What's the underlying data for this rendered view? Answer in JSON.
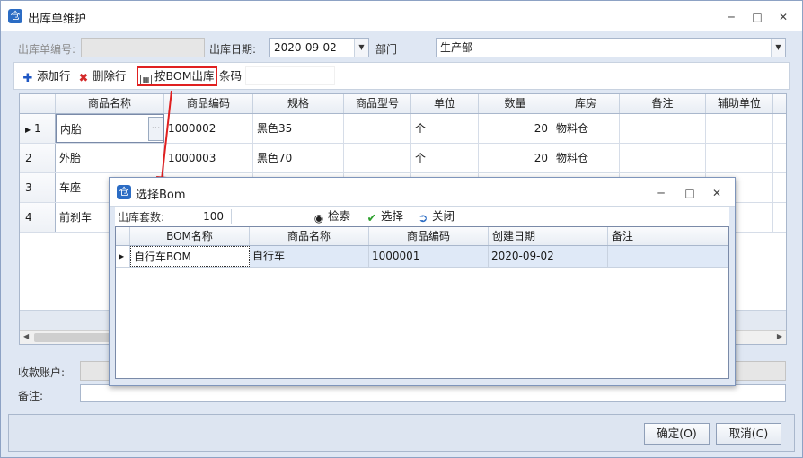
{
  "window": {
    "title": "出库单维护"
  },
  "form": {
    "order_no_label": "出库单编号:",
    "order_no_value": "",
    "date_label": "出库日期:",
    "date_value": "2020-09-02",
    "dept_label": "部门",
    "dept_value": "生产部",
    "account_label": "收款账户:",
    "account_value": "",
    "remark_label": "备注:",
    "remark_value": ""
  },
  "toolbar": {
    "add_label": "添加行",
    "delete_label": "删除行",
    "bom_label": "按BOM出库",
    "barcode_label": "条码",
    "barcode_value": ""
  },
  "grid": {
    "columns": [
      "商品名称",
      "商品编码",
      "规格",
      "商品型号",
      "单位",
      "数量",
      "库房",
      "备注",
      "辅助单位"
    ],
    "rows": [
      {
        "no": "1",
        "name": "内胎",
        "code": "1000002",
        "spec": "黑色35",
        "model": "",
        "unit": "个",
        "qty": "20",
        "warehouse": "物料仓",
        "note": "",
        "aux": ""
      },
      {
        "no": "2",
        "name": "外胎",
        "code": "1000003",
        "spec": "黑色70",
        "model": "",
        "unit": "个",
        "qty": "20",
        "warehouse": "物料仓",
        "note": "",
        "aux": ""
      },
      {
        "no": "3",
        "name": "车座",
        "code": "",
        "spec": "",
        "model": "",
        "unit": "",
        "qty": "",
        "warehouse": "",
        "note": "",
        "aux": ""
      },
      {
        "no": "4",
        "name": "前刹车",
        "code": "",
        "spec": "",
        "model": "",
        "unit": "",
        "qty": "",
        "warehouse": "",
        "note": "",
        "aux": ""
      }
    ],
    "ellipsis": "···"
  },
  "buttons": {
    "ok_label": "确定(O)",
    "cancel_label": "取消(C)"
  },
  "dialog": {
    "title": "选择Bom",
    "sets_label": "出库套数:",
    "sets_value": "100",
    "search_label": "检索",
    "select_label": "选择",
    "close_label": "关闭",
    "columns": [
      "BOM名称",
      "商品名称",
      "商品编码",
      "创建日期",
      "备注"
    ],
    "rows": [
      {
        "bom": "自行车BOM",
        "name": "自行车",
        "code": "1000001",
        "date": "2020-09-02",
        "note": ""
      }
    ]
  },
  "icons": [
    "app-icon",
    "minimize-icon",
    "maximize-icon",
    "close-icon",
    "add-icon",
    "delete-icon",
    "table-icon",
    "binoculars-icon",
    "check-icon",
    "exit-icon",
    "dropdown-arrow-icon",
    "row-pointer-icon",
    "arrow-annotation"
  ],
  "colors": {
    "accent": "#2b6cc4",
    "highlight_box": "#e02020",
    "selected_row": "#dfe9f7"
  }
}
